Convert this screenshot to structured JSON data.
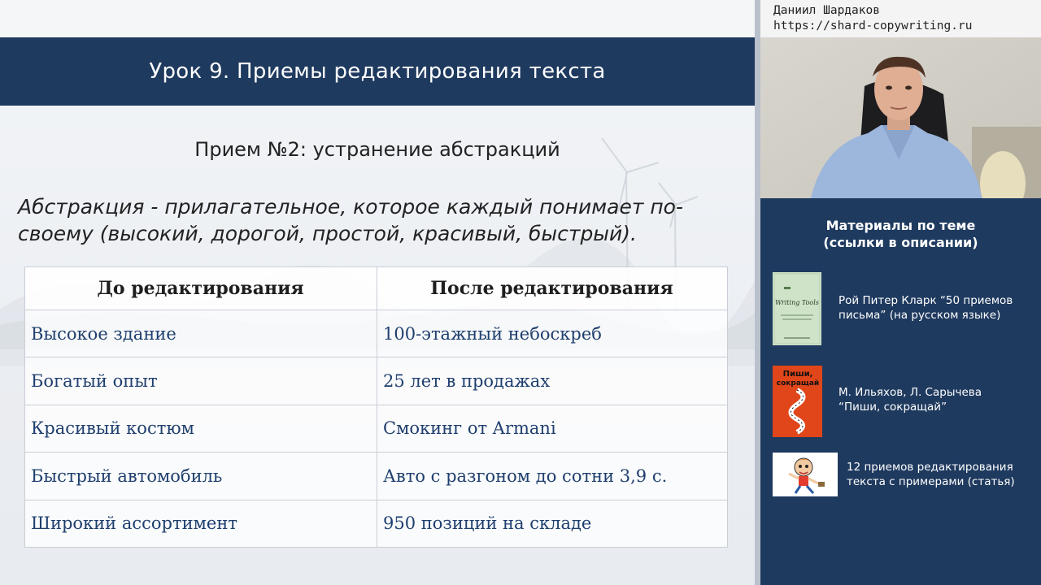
{
  "slide": {
    "title": "Урок 9. Приемы редактирования текста",
    "subtitle": "Прием №2: устранение абстракций",
    "definition": "Абстракция - прилагательное, которое каждый понимает по-своему (высокий, дорогой, простой, красивый, быстрый).",
    "definition_line1": "Абстракция - прилагательное, которое каждый понимает по-",
    "definition_line2": "своему (высокий, дорогой, простой, красивый, быстрый).",
    "table": {
      "headers": [
        "До редактирования",
        "После редактирования"
      ],
      "rows": [
        [
          "Высокое здание",
          "100-этажный небоскреб"
        ],
        [
          "Богатый опыт",
          "25 лет в продажах"
        ],
        [
          "Красивый костюм",
          "Смокинг от Armani"
        ],
        [
          "Быстрый автомобиль",
          "Авто с разгоном до сотни 3,9 с."
        ],
        [
          "Широкий ассортимент",
          "950 позиций на складе"
        ]
      ]
    }
  },
  "sidebar": {
    "presenter": {
      "name": "Даниил Шардаков",
      "url": "https://shard-copywriting.ru"
    },
    "materials_title_line1": "Материалы по теме",
    "materials_title_line2": "(ссылки в описании)",
    "materials": [
      {
        "line1": "Рой Питер Кларк “50 приемов",
        "line2": "письма” (на русском языке)",
        "cover_text": "Writing Tools",
        "icon": "book-cover-writing-tools-icon"
      },
      {
        "line1": "М. Ильяхов, Л. Сарычева",
        "line2": "“Пиши, сокращай”",
        "cover_text_line1": "Пиши,",
        "cover_text_line2": "сокращай",
        "icon": "book-cover-pishi-sokrashchai-icon"
      },
      {
        "line1": "12 приемов редактирования",
        "line2": "текста с примерами (статья)",
        "icon": "article-cartoon-icon"
      }
    ]
  },
  "colors": {
    "navy": "#1f3a5f",
    "table_text": "#1f3f6e",
    "slide_bg": "#eceff3",
    "pishi_cover": "#e0461a",
    "writing_tools_cover": "#cfe3c8"
  }
}
